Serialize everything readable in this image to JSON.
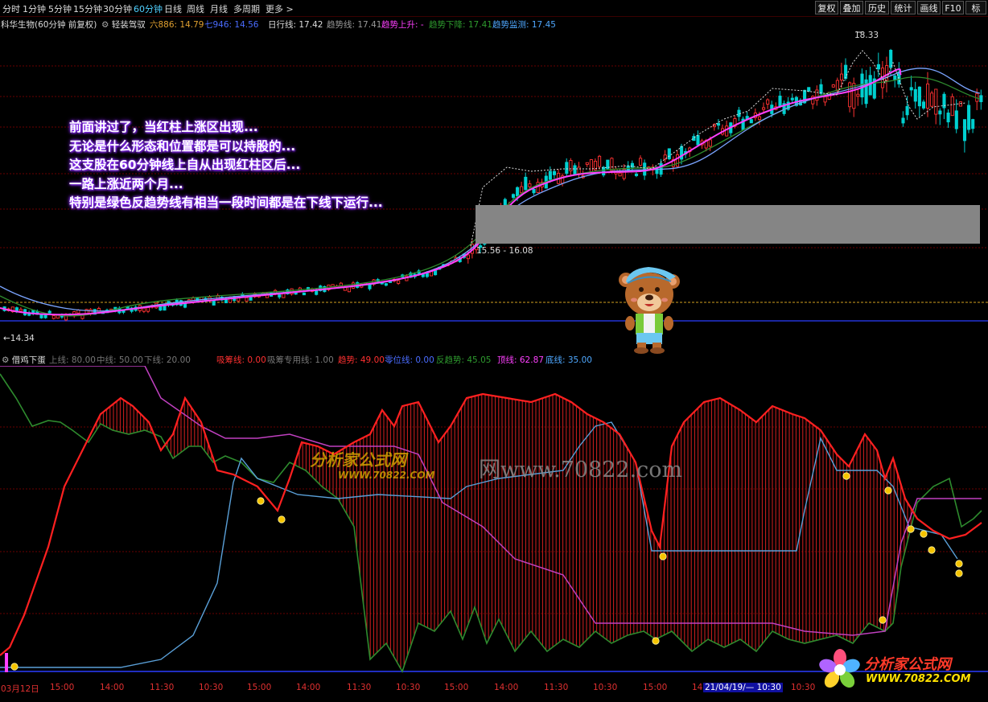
{
  "toolbar": {
    "tabs": [
      "分时",
      "1分钟",
      "5分钟",
      "15分钟",
      "30分钟",
      "60分钟",
      "日线",
      "周线",
      "月线",
      "多周期",
      "更多 >"
    ],
    "active_tab": "60分钟",
    "right_buttons": [
      "复权",
      "叠加",
      "历史",
      "统计",
      "画线",
      "F10",
      "标"
    ]
  },
  "main_info": {
    "stock": "科华生物(60分钟 前复权)",
    "mode": "轻装驾驭",
    "ma6": "六886: 14.79",
    "ma7": "七946: 14.56",
    "day_line": "日行线: 17.42",
    "trend_line": "趋势线: 17.41",
    "trend_up": "趋势上升: -",
    "trend_down": "趋势下降: 17.41",
    "trend_monitor": "趋势监测: 17.45"
  },
  "price_labels": {
    "max": "18.33",
    "min": "←14.34",
    "range": "15.56 - 16.08"
  },
  "annotation": [
    "前面讲过了，当红柱上涨区出现...",
    "无论是什么形态和位置都是可以持股的...",
    "这支股在60分钟线上自从出现红柱区后...",
    "一路上涨近两个月...",
    "特别是绿色反趋势线有相当一段时间都是在下线下运行..."
  ],
  "indicator_info": {
    "name": "借鸡下蛋",
    "upper": "上线: 80.00",
    "middle": "中线: 50.00",
    "lower": "下线: 20.00",
    "chip": "吸筹线: 0.00",
    "chip_special": "吸筹专用线: 1.00",
    "trend": "趋势: 49.00",
    "zero_line": "零位线: 0.00",
    "anti_trend": "反趋势: 45.05",
    "top_line": "顶线: 62.87",
    "bottom_line": "底线: 35.00"
  },
  "time_axis": [
    "03月12日",
    "15:00",
    "14:00",
    "11:30",
    "10:30",
    "15:00",
    "14:00",
    "11:30",
    "10:30",
    "15:00",
    "14:00",
    "11:30",
    "10:30",
    "15:00",
    "14",
    "21/04/19/— 10:30",
    "10:30"
  ],
  "watermark": {
    "a": "分析家公式网",
    "b": "WWW.70822.COM",
    "c": "网www.70822.com"
  },
  "brand": {
    "name": "分析家公式网",
    "url": "WWW.70822.COM"
  },
  "colors": {
    "up": "#ff3232",
    "down": "#00d0d0",
    "ma_magenta": "#ff40ff",
    "ma_blue": "#7aa4ff",
    "trend_red": "#ff2020",
    "anti_green": "#2e8b2e",
    "top_magenta": "#c040c0",
    "line_blue": "#5aa0d8"
  }
}
